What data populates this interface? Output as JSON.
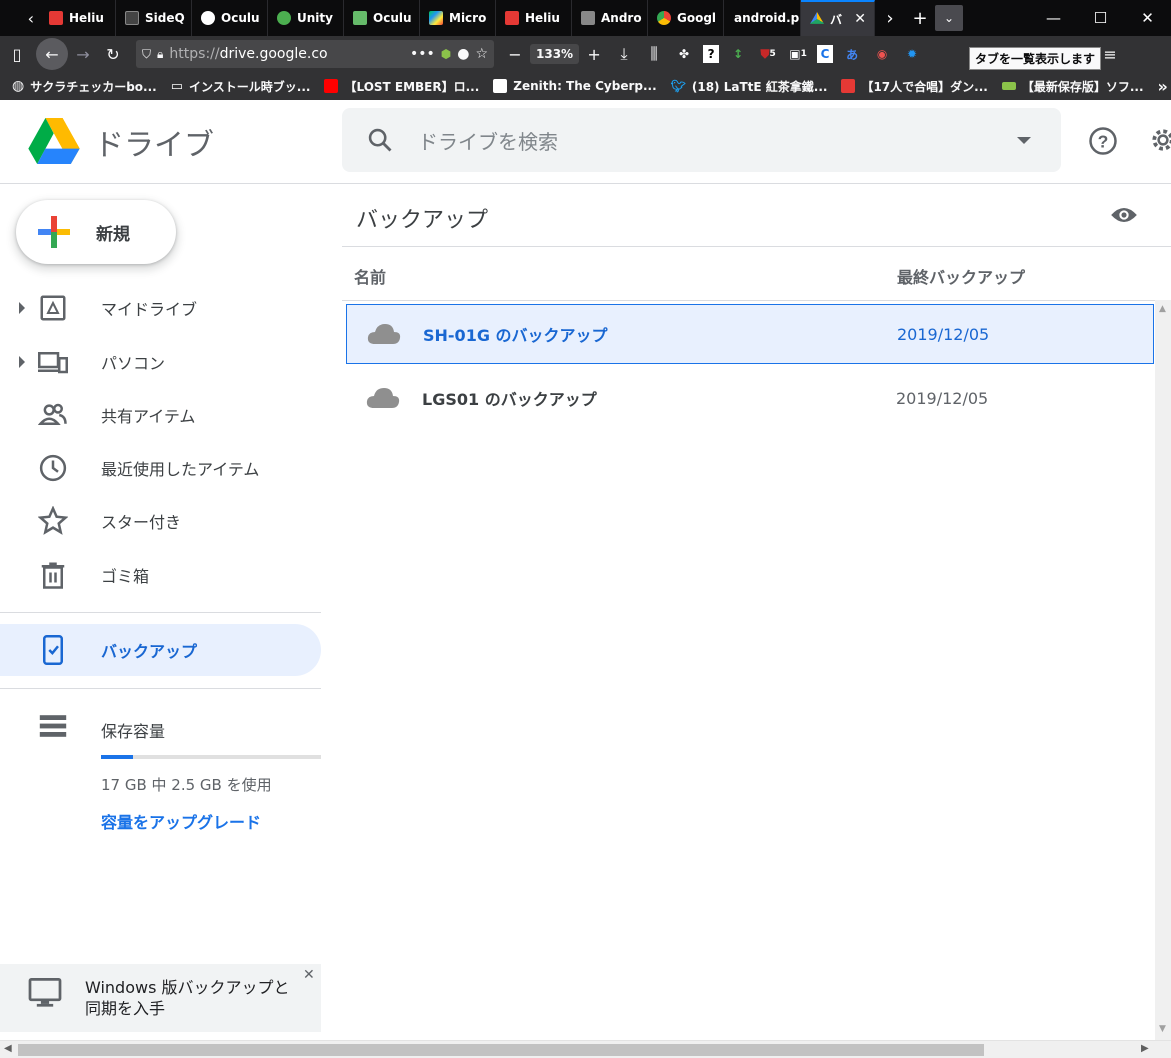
{
  "browser": {
    "tabs": [
      {
        "label": "Heliu",
        "color": "#e53935"
      },
      {
        "label": "SideQ",
        "color": "#444444"
      },
      {
        "label": "Oculu",
        "color": "#ffffff"
      },
      {
        "label": "Unity",
        "color": "#4caf50"
      },
      {
        "label": "Oculu",
        "color": "#66bb6a"
      },
      {
        "label": "Micro",
        "color": "#1e88e5"
      },
      {
        "label": "Heliu",
        "color": "#e53935"
      },
      {
        "label": "Andro",
        "color": "#888888"
      },
      {
        "label": "Googl",
        "color": "#fbbc04"
      },
      {
        "label": "android.p",
        "color": ""
      },
      {
        "label": "バ",
        "color": "#1fa463",
        "active": true
      }
    ],
    "url_prefix": "https://",
    "url_host": "drive.google.co",
    "zoom": "133%",
    "tooltip": "タブを一覧表示します",
    "ext_badge_1": "5",
    "ext_badge_2": "1",
    "bookmarks": [
      {
        "label": "サクラチェッカーbo...",
        "color": "#dddddd"
      },
      {
        "label": "インストール時ブッ...",
        "color": "#bdbdbd"
      },
      {
        "label": "【LOST EMBER】ロ...",
        "color": "#ff0000"
      },
      {
        "label": "Zenith: The Cyberp...",
        "color": "#ffffff"
      },
      {
        "label": "(18) LaTtE 紅茶拿鐵...",
        "color": "#1da1f2"
      },
      {
        "label": "【17人で合唱】ダン...",
        "color": "#e53935"
      },
      {
        "label": "【最新保存版】ソフ...",
        "color": "#8bc34a"
      }
    ]
  },
  "drive": {
    "brand": "ドライブ",
    "search_placeholder": "ドライブを検索",
    "new_label": "新規",
    "nav": [
      {
        "label": "マイドライブ"
      },
      {
        "label": "パソコン"
      },
      {
        "label": "共有アイテム"
      },
      {
        "label": "最近使用したアイテム"
      },
      {
        "label": "スター付き"
      },
      {
        "label": "ゴミ箱"
      },
      {
        "label": "バックアップ"
      }
    ],
    "storage_label": "保存容量",
    "storage_usage": "17 GB 中 2.5 GB を使用",
    "storage_fraction": 0.147,
    "upgrade_label": "容量をアップグレード",
    "promo_text": "Windows 版バックアップと同期を入手",
    "page_title": "バックアップ",
    "col_name": "名前",
    "col_date": "最終バックアップ",
    "rows": [
      {
        "name": "SH-01G のバックアップ",
        "date": "2019/12/05",
        "selected": true
      },
      {
        "name": "LGS01 のバックアップ",
        "date": "2019/12/05",
        "selected": false
      }
    ],
    "colors": {
      "accent": "#1a73e8",
      "selected_bg": "#e8f0fe"
    }
  }
}
